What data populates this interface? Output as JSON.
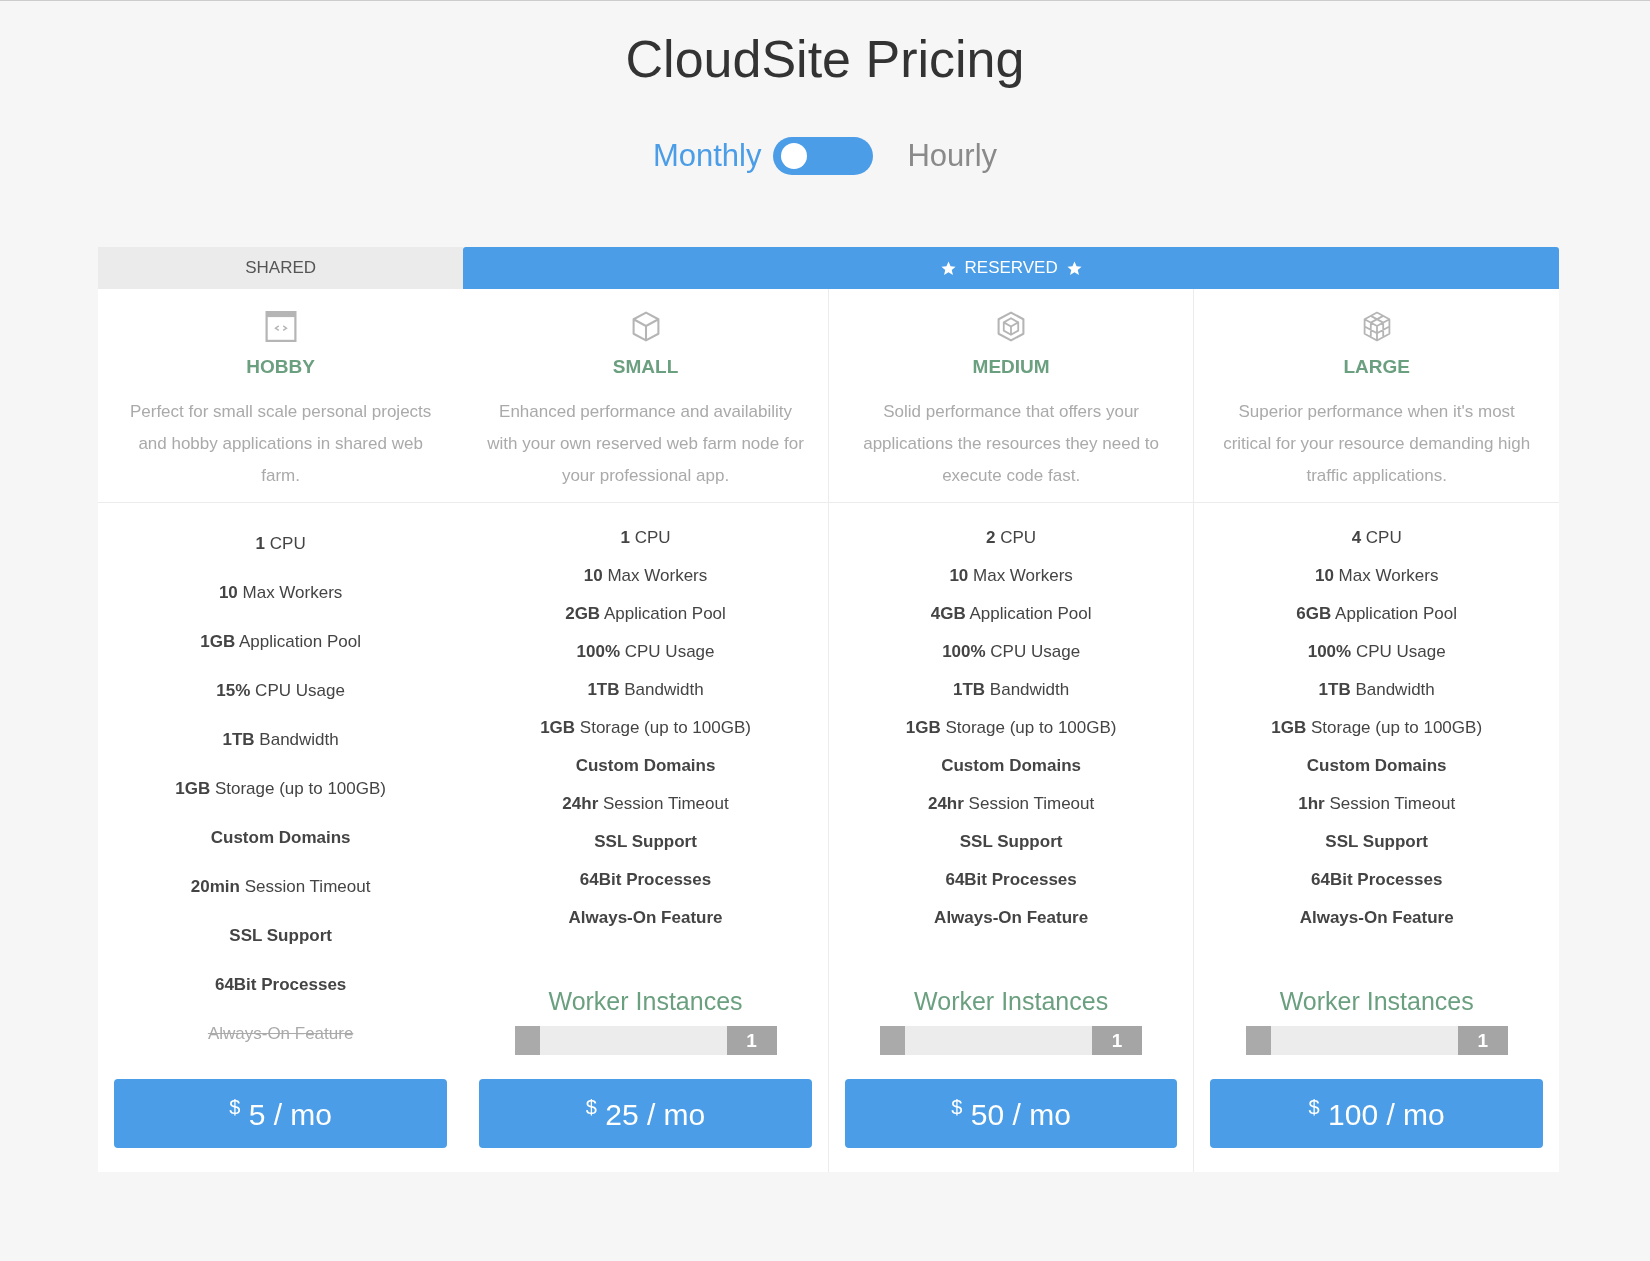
{
  "title": "CloudSite Pricing",
  "billing": [
    {
      "label": "Monthly",
      "selected": true
    },
    {
      "label": "Hourly",
      "selected": false
    }
  ],
  "groups": [
    {
      "label": "SHARED",
      "kind": "shared",
      "plans": [
        {
          "name": "HOBBY",
          "description": "Perfect for small scale personal projects and hobby applications in shared web farm.",
          "features": [
            {
              "text": "**1** CPU",
              "kind": "mixed"
            },
            {
              "text": "**10** Max Workers",
              "kind": "mixed"
            },
            {
              "text": "**1GB** Application Pool",
              "kind": "mixed"
            },
            {
              "text": "**15%** CPU Usage",
              "kind": "mixed"
            },
            {
              "text": "**1TB** Bandwidth",
              "kind": "mixed"
            },
            {
              "text": "**1GB** Storage (up to 100GB)",
              "kind": "mixed"
            },
            {
              "text": "Custom Domains",
              "kind": "bold"
            },
            {
              "text": "**20min** Session Timeout",
              "kind": "mixed"
            },
            {
              "text": "SSL Support",
              "kind": "bold"
            },
            {
              "text": "64Bit Processes",
              "kind": "bold"
            },
            {
              "text": "Always-On Feature",
              "kind": "unavailable"
            }
          ],
          "currency": "$",
          "price": "5 / mo"
        }
      ]
    },
    {
      "label": "RESERVED",
      "kind": "reserved",
      "plans": [
        {
          "name": "SMALL",
          "description": "Enhanced performance and availability with your own reserved web farm node for your professional app.",
          "features": [
            {
              "text": "**1** CPU",
              "kind": "mixed"
            },
            {
              "text": "**10** Max Workers",
              "kind": "mixed"
            },
            {
              "text": "**2GB** Application Pool",
              "kind": "mixed"
            },
            {
              "text": "**100%** CPU Usage",
              "kind": "mixed"
            },
            {
              "text": "**1TB** Bandwidth",
              "kind": "mixed"
            },
            {
              "text": "**1GB** Storage (up to 100GB)",
              "kind": "mixed"
            },
            {
              "text": "Custom Domains",
              "kind": "bold"
            },
            {
              "text": "**24hr** Session Timeout",
              "kind": "mixed"
            },
            {
              "text": "SSL Support",
              "kind": "bold"
            },
            {
              "text": "64Bit Processes",
              "kind": "bold"
            },
            {
              "text": "Always-On Feature",
              "kind": "bold"
            }
          ],
          "slider": {
            "label": "Worker Instances",
            "level": 0,
            "value": "1"
          },
          "currency": "$",
          "price": "25 / mo"
        },
        {
          "name": "MEDIUM",
          "description": "Solid performance that offers your applications the resources they need to execute code fast.",
          "features": [
            {
              "text": "**2** CPU",
              "kind": "mixed"
            },
            {
              "text": "**10** Max Workers",
              "kind": "mixed"
            },
            {
              "text": "**4GB** Application Pool",
              "kind": "mixed"
            },
            {
              "text": "**100%** CPU Usage",
              "kind": "mixed"
            },
            {
              "text": "**1TB** Bandwidth",
              "kind": "mixed"
            },
            {
              "text": "**1GB** Storage (up to 100GB)",
              "kind": "mixed"
            },
            {
              "text": "Custom Domains",
              "kind": "bold"
            },
            {
              "text": "**24hr** Session Timeout",
              "kind": "mixed"
            },
            {
              "text": "SSL Support",
              "kind": "bold"
            },
            {
              "text": "64Bit Processes",
              "kind": "bold"
            },
            {
              "text": "Always-On Feature",
              "kind": "bold"
            }
          ],
          "slider": {
            "label": "Worker Instances",
            "level": 0,
            "value": "1"
          },
          "currency": "$",
          "price": "50 / mo"
        },
        {
          "name": "LARGE",
          "description": "Superior performance when it's most critical for your resource demanding high traffic applications.",
          "features": [
            {
              "text": "**4** CPU",
              "kind": "mixed"
            },
            {
              "text": "**10** Max Workers",
              "kind": "mixed"
            },
            {
              "text": "**6GB** Application Pool",
              "kind": "mixed"
            },
            {
              "text": "**100%** CPU Usage",
              "kind": "mixed"
            },
            {
              "text": "**1TB** Bandwidth",
              "kind": "mixed"
            },
            {
              "text": "**1GB** Storage (up to 100GB)",
              "kind": "mixed"
            },
            {
              "text": "Custom Domains",
              "kind": "bold"
            },
            {
              "text": "**1hr** Session Timeout",
              "kind": "mixed"
            },
            {
              "text": "SSL Support",
              "kind": "bold"
            },
            {
              "text": "64Bit Processes",
              "kind": "bold"
            },
            {
              "text": "Always-On Feature",
              "kind": "bold"
            }
          ],
          "slider": {
            "label": "Worker Instances",
            "level": 0,
            "value": "1"
          },
          "currency": "$",
          "price": "100 / mo"
        }
      ]
    }
  ]
}
